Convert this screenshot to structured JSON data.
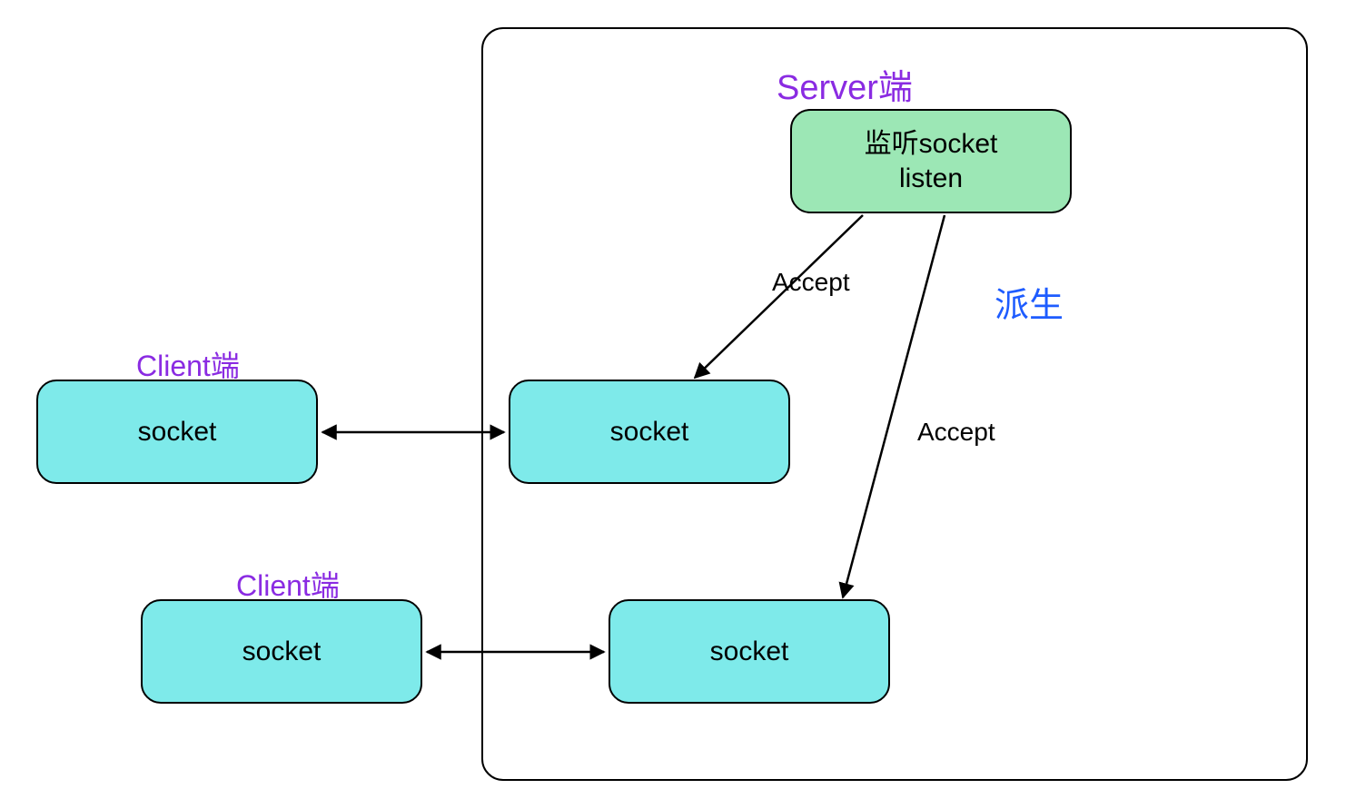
{
  "server": {
    "title": "Server端",
    "listen_box_line1": "监听socket",
    "listen_box_line2": "listen",
    "socket1": "socket",
    "socket2": "socket",
    "accept1": "Accept",
    "accept2": "Accept",
    "derive": "派生"
  },
  "client1": {
    "title": "Client端",
    "socket": "socket"
  },
  "client2": {
    "title": "Client端",
    "socket": "socket"
  },
  "colors": {
    "cyan": "#7EEAEA",
    "green": "#9CE7B5",
    "purple": "#8A2BE2",
    "blue": "#1E5CFF"
  }
}
